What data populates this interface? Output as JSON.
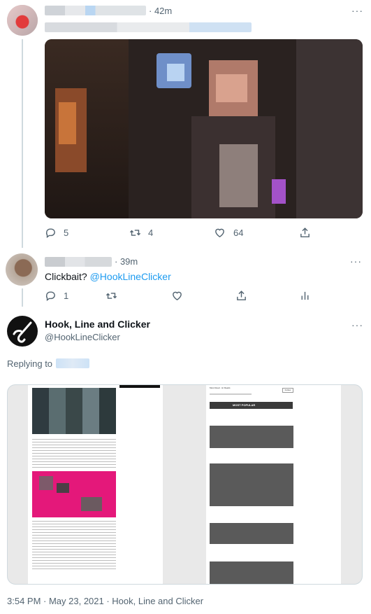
{
  "tweet1": {
    "time": "· 42m",
    "more": "···",
    "actions": {
      "replies": "5",
      "retweets": "4",
      "likes": "64"
    }
  },
  "tweet2": {
    "time": "· 39m",
    "more": "···",
    "text_plain": "Clickbait?",
    "mention": "@HookLineClicker",
    "actions": {
      "replies": "1"
    }
  },
  "main_tweet": {
    "display_name": "Hook, Line and Clicker",
    "handle": "@HookLineClicker",
    "more": "···",
    "replying_to": "Replying to",
    "meta": "3:54 PM · May 23, 2021 · Hook, Line and Clicker"
  },
  "embedded_page": {
    "right_header_title": "Most Read · Hi Reads",
    "right_button": "Follow",
    "right_section": "MOST POPULAR"
  },
  "colors": {
    "accent": "#1d9bf0",
    "text": "#0f1419",
    "muted": "#536471",
    "pink": "#e4187a"
  }
}
